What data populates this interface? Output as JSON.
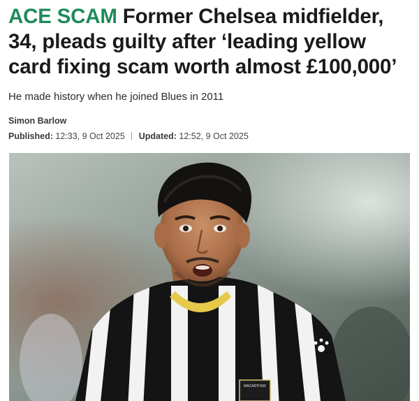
{
  "article": {
    "kicker": "ACE SCAM",
    "headline": "Former Chelsea midfielder, 34, pleads guilty after ‘leading yellow card fixing scam worth almost £100,000’",
    "standfirst": "He made history when he joined Blues in 2011",
    "author": "Simon Barlow",
    "published_label": "Published:",
    "published_time": "12:33, 9 Oct 2025",
    "updated_label": "Updated:",
    "updated_time": "12:52, 9 Oct 2025"
  },
  "photo": {
    "subject": "footballer-in-black-and-white-striped-shirt",
    "sponsor_badge_text": "MACARTHUR",
    "colors": {
      "kicker": "#1f8a5a",
      "shirt_black": "#141414",
      "shirt_white": "#f2f2f2",
      "collar": "#e6c84a"
    }
  }
}
